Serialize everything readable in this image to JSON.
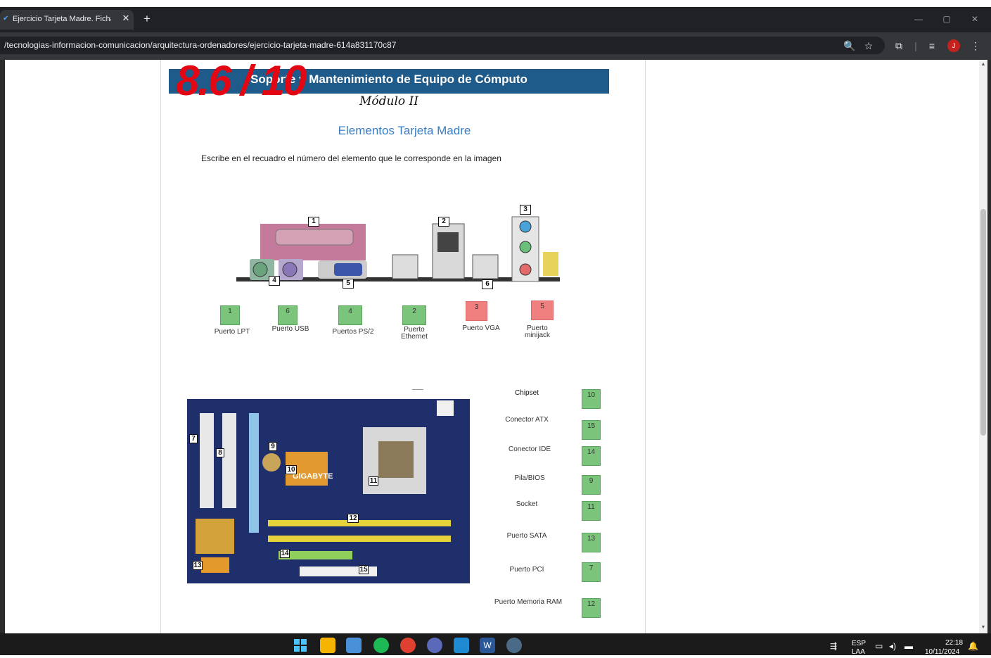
{
  "browser": {
    "tab_title": "Ejercicio Tarjeta Madre. Ficha in",
    "tab_close": "✕",
    "new_tab": "+",
    "url": "/tecnologias-informacion-comunicacion/arquitectura-ordenadores/ejercicio-tarjeta-madre-614a831170c87",
    "avatar_letter": "J",
    "window_controls": [
      "—",
      "▢",
      "✕"
    ]
  },
  "worksheet": {
    "banner": "Soporte y Mantenimiento de Equipo de Cómputo",
    "module": "Módulo II",
    "score": "8.6 / 10",
    "section_title": "Elementos Tarjeta Madre",
    "instruction": "Escribe en el recuadro el número del elemento que le corresponde en la imagen"
  },
  "ports_image_markers": [
    "1",
    "2",
    "3",
    "4",
    "5",
    "6"
  ],
  "ports_answers": [
    {
      "label_line1": "Puerto LPT",
      "label_line2": "",
      "answer": "1",
      "status": "correct"
    },
    {
      "label_line1": "Puerto USB",
      "label_line2": "",
      "answer": "6",
      "status": "correct"
    },
    {
      "label_line1": "Puertos PS/2",
      "label_line2": "",
      "answer": "4",
      "status": "correct"
    },
    {
      "label_line1": "Puerto",
      "label_line2": "Ethernet",
      "answer": "2",
      "status": "correct"
    },
    {
      "label_line1": "Puerto VGA",
      "label_line2": "",
      "answer": "3",
      "status": "incorrect"
    },
    {
      "label_line1": "Puerto",
      "label_line2": "minijack",
      "answer": "5",
      "status": "incorrect"
    }
  ],
  "board_image_markers": [
    "7",
    "8",
    "9",
    "10",
    "11",
    "12",
    "13",
    "14",
    "15"
  ],
  "board_brand": "GIGABYTE",
  "board_answers": [
    {
      "label": "Chipset",
      "answer": "10",
      "status": "correct"
    },
    {
      "label": "Conector ATX",
      "answer": "15",
      "status": "correct"
    },
    {
      "label": "Conector IDE",
      "answer": "14",
      "status": "correct"
    },
    {
      "label": "Pila/BIOS",
      "answer": "9",
      "status": "correct"
    },
    {
      "label": "Socket",
      "answer": "11",
      "status": "correct"
    },
    {
      "label": "Puerto SATA",
      "answer": "13",
      "status": "correct"
    },
    {
      "label": "Puerto PCI",
      "answer": "7",
      "status": "correct"
    },
    {
      "label": "Puerto Memoria RAM",
      "answer": "12",
      "status": "correct"
    }
  ],
  "taskbar": {
    "lang": "ESP",
    "lang_sub": "LAA",
    "time": "22:18",
    "date": "10/11/2024"
  },
  "colors": {
    "correct": "#7bc47b",
    "incorrect": "#f08080",
    "banner": "#1e5a8a",
    "title": "#3a7dc0",
    "score": "#e30613"
  }
}
